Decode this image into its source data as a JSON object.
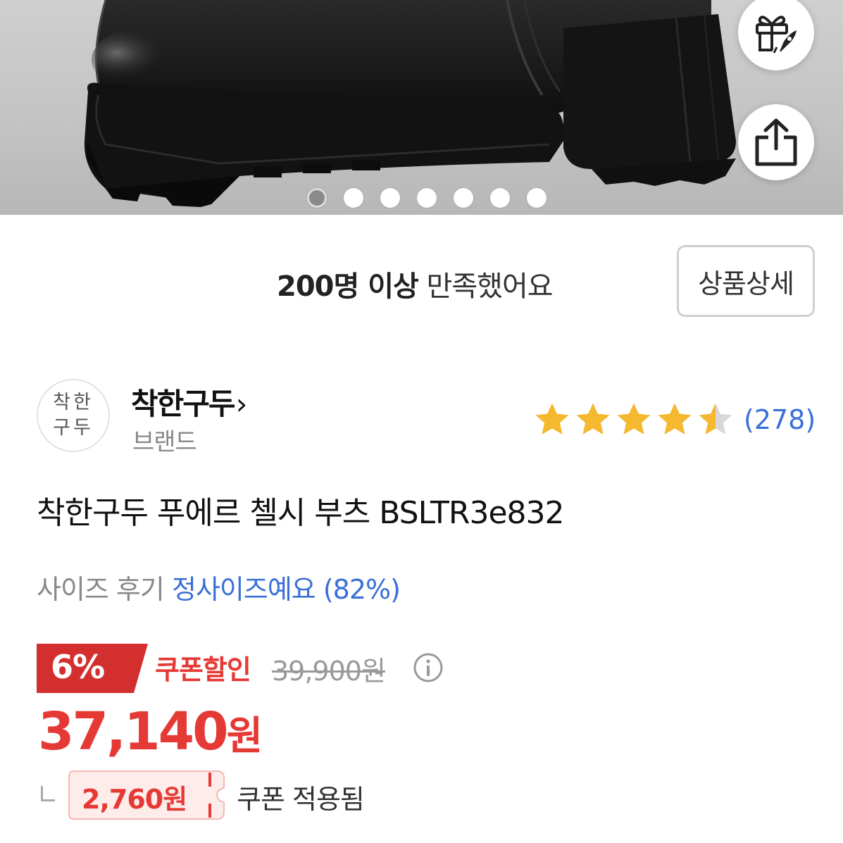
{
  "gallery": {
    "total_images": 7,
    "active_index": 0
  },
  "actions": {
    "gift_icon": "gift-rocket-icon",
    "share_icon": "share-icon"
  },
  "satisfaction": {
    "strong": "200명 이상",
    "rest": "만족했어요"
  },
  "detail_button": "상품상세",
  "brand": {
    "logo_line1": "착한",
    "logo_line2": "구두",
    "name": "착한구두",
    "chevron": "›",
    "sub": "브랜드"
  },
  "rating": {
    "score": 4.5,
    "max": 5,
    "count": "(278)",
    "star_color": "#f5b82e",
    "empty_color": "#d8d8d8"
  },
  "product": {
    "title": "착한구두 푸에르 첼시 부츠 BSLTR3e832"
  },
  "size_review": {
    "label": "사이즈 후기",
    "value": "정사이즈예요 (82%)"
  },
  "price": {
    "discount": "6%",
    "coupon_label": "쿠폰할인",
    "original": "39,900원",
    "final_amount": "37,140",
    "final_unit": "원",
    "coupon_amount": "2,760원",
    "coupon_applied": "쿠폰 적용됨",
    "accent": "#e53935",
    "tag_color": "#d32f2f"
  }
}
